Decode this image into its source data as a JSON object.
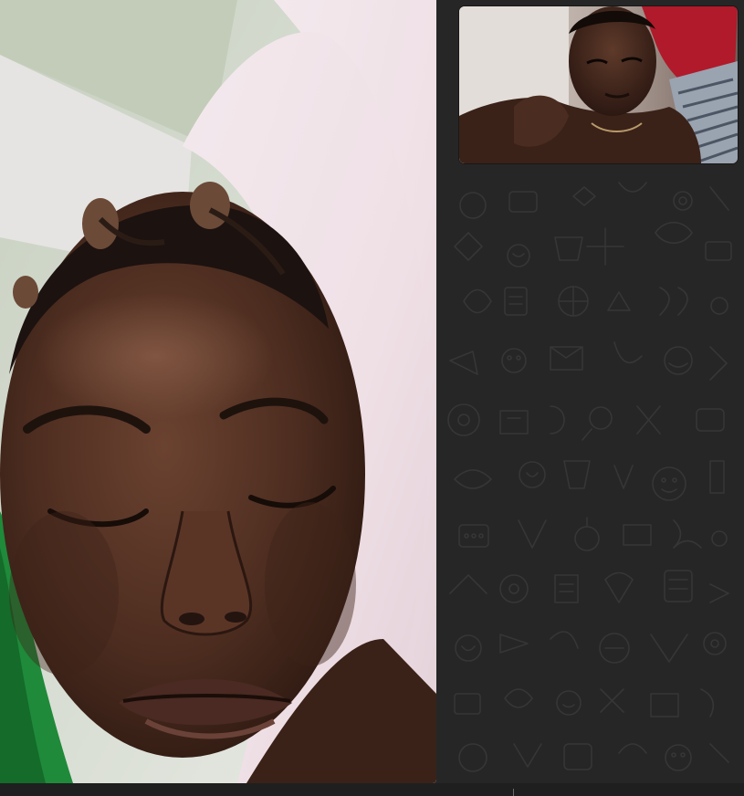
{
  "call": {
    "type": "video",
    "participants": [
      {
        "role": "remote",
        "label": ""
      },
      {
        "role": "self",
        "label": ""
      }
    ]
  },
  "icons": {
    "background_pattern": "doodle-pattern-icon"
  },
  "colors": {
    "panel_background": "#262626",
    "pattern_stroke": "#363636",
    "bottom_bar": "#1f1f1f"
  }
}
